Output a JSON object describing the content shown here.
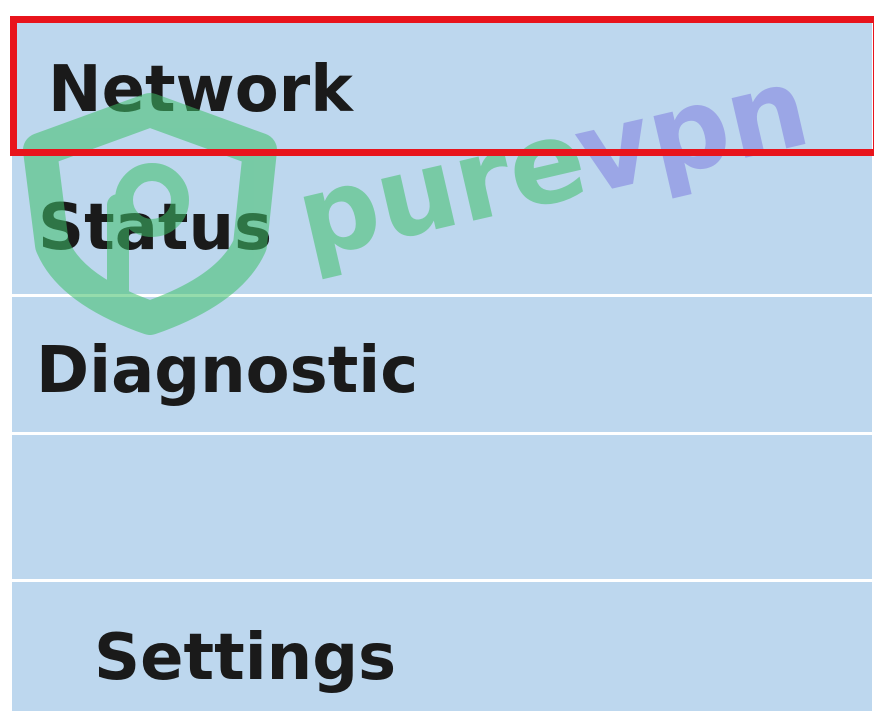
{
  "menu": {
    "items": [
      {
        "label": "Network"
      },
      {
        "label": "Status"
      },
      {
        "label": "Diagnostic"
      },
      {
        "label": ""
      },
      {
        "label": "Settings"
      }
    ]
  },
  "watermark": {
    "text": "purevpn",
    "colors": {
      "pure": "#3fc06a",
      "vpn": "#7f7de0",
      "shield": "#3fc06a"
    }
  },
  "colors": {
    "menu_background": "#bdd7ee",
    "divider": "#ffffff",
    "highlight_border": "#e8141c",
    "text": "#1a1a1a"
  }
}
